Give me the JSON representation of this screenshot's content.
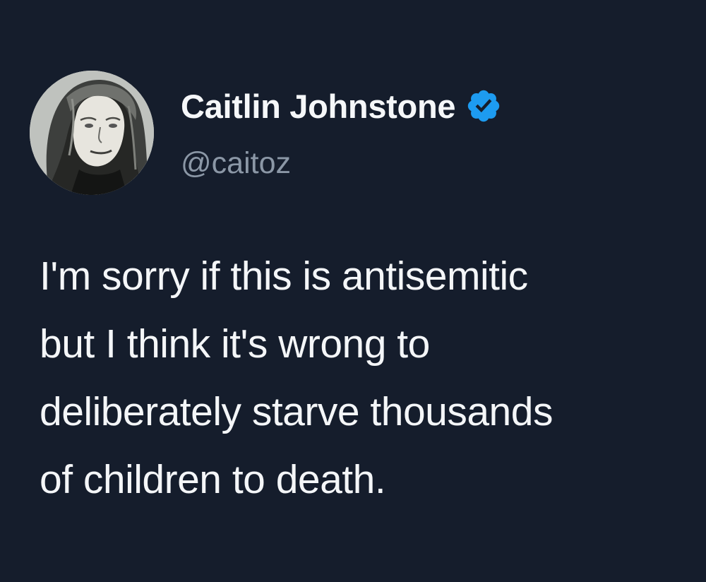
{
  "author": {
    "display_name": "Caitlin Johnstone",
    "handle": "@caitoz",
    "verified": true,
    "verified_icon": "verified-badge-icon",
    "verified_color": "#1d9bf0"
  },
  "tweet": {
    "lines": [
      "I'm sorry if this is antisemitic",
      "but I think it's wrong to",
      "deliberately starve thousands",
      "of children to death."
    ]
  },
  "theme": {
    "background": "#151d2c",
    "text": "#f4f6f8",
    "secondary_text": "#8b97a6"
  }
}
